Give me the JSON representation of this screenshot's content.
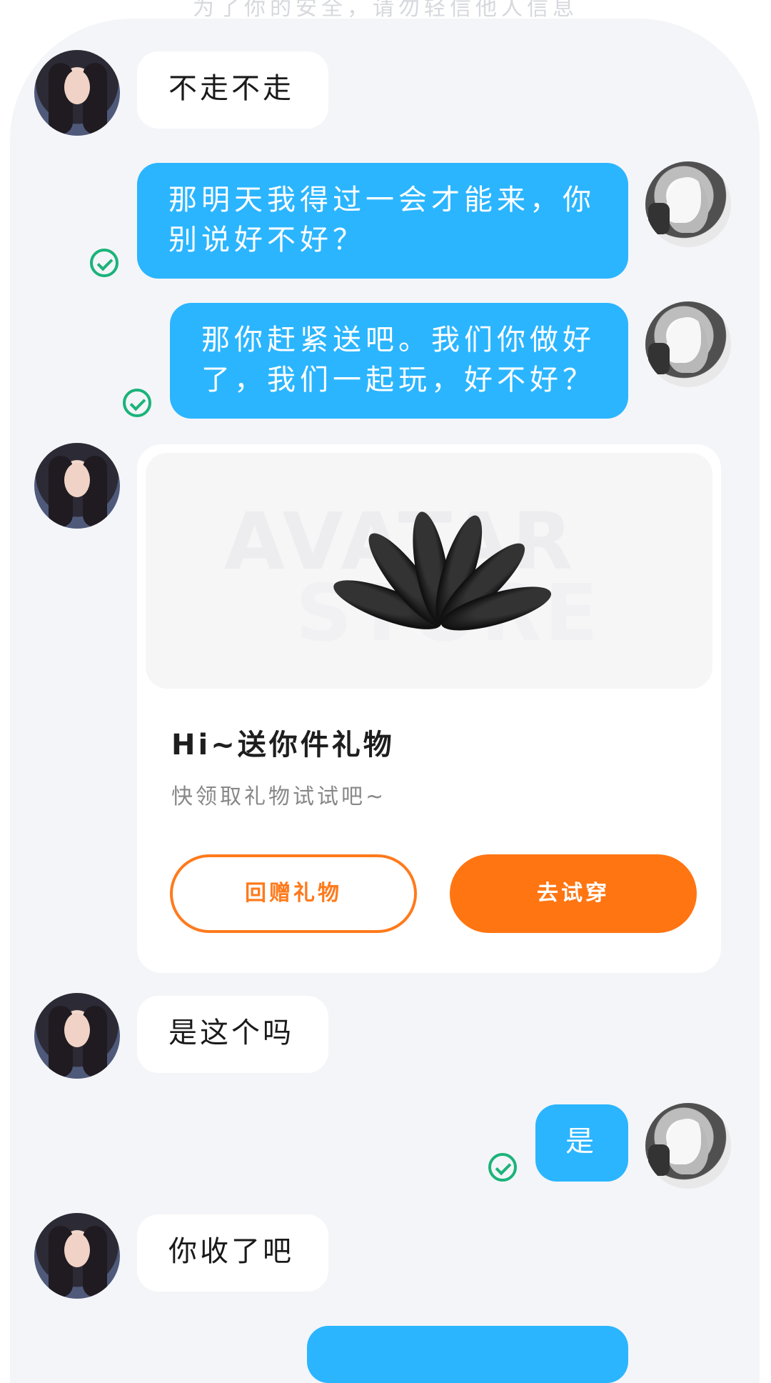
{
  "top_hint": "为了你的安全，请勿轻信他人信息",
  "messages": [
    {
      "from": "them",
      "text": "不走不走"
    },
    {
      "from": "me",
      "text": "那明天我得过一会才能来，你别说好不好？"
    },
    {
      "from": "me",
      "text": "那你赶紧送吧。我们你做好了，我们一起玩，好不好？"
    },
    {
      "from": "them",
      "type": "gift_card"
    },
    {
      "from": "them",
      "text": "是这个吗"
    },
    {
      "from": "me",
      "text": "是"
    },
    {
      "from": "them",
      "text": "你收了吧"
    }
  ],
  "gift_card": {
    "watermark_line1": "AVATAR",
    "watermark_line2": "STORE",
    "title": "Hi~送你件礼物",
    "subtitle": "快领取礼物试试吧~",
    "return_button": "回赠礼物",
    "try_button": "去试穿"
  },
  "colors": {
    "outgoing_bubble": "#2bb5ff",
    "incoming_bubble": "#ffffff",
    "read_check": "#1bb37a",
    "accent_orange": "#ff7512",
    "panel_bg": "#f4f5f8"
  },
  "icons": [
    "read-check-icon",
    "hair-accessory-icon"
  ]
}
